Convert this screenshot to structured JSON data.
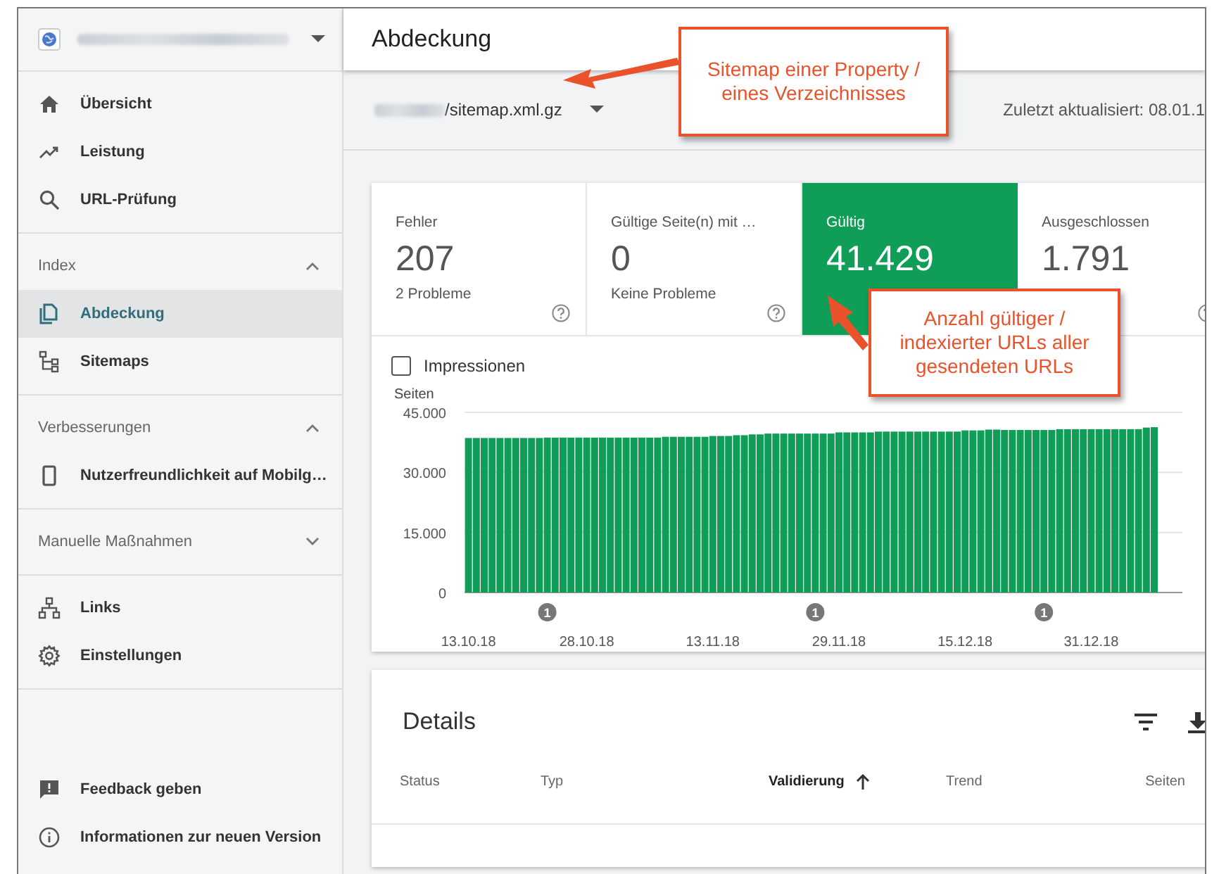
{
  "sidebar": {
    "sections": [
      {
        "items": [
          {
            "label": "Übersicht",
            "selected": false
          },
          {
            "label": "Leistung",
            "selected": false
          },
          {
            "label": "URL-Prüfung",
            "selected": false
          }
        ]
      },
      {
        "title": "Index",
        "expanded": true,
        "items": [
          {
            "label": "Abdeckung",
            "selected": true
          },
          {
            "label": "Sitemaps",
            "selected": false
          }
        ]
      },
      {
        "title": "Verbesserungen",
        "expanded": true,
        "items": [
          {
            "label": "Nutzerfreundlichkeit auf Mobilg…",
            "selected": false
          }
        ]
      },
      {
        "title": "Manuelle Maßnahmen",
        "expanded": false
      },
      {
        "items": [
          {
            "label": "Links",
            "selected": false
          },
          {
            "label": "Einstellungen",
            "selected": false
          }
        ]
      }
    ],
    "footer": [
      {
        "label": "Feedback geben"
      },
      {
        "label": "Informationen zur neuen Version"
      }
    ]
  },
  "page": {
    "title": "Abdeckung"
  },
  "toolbar": {
    "sitemap": "/sitemap.xml.gz",
    "updated": "Zuletzt aktualisiert: 08.01.1"
  },
  "tiles": [
    {
      "label": "Fehler",
      "value": "207",
      "caption": "2 Probleme",
      "selected": false
    },
    {
      "label": "Gültige Seite(n) mit …",
      "value": "0",
      "caption": "Keine Probleme",
      "selected": false
    },
    {
      "label": "Gültig",
      "value": "41.429",
      "selected": true
    },
    {
      "label": "Ausgeschlossen",
      "value": "1.791",
      "selected": false
    }
  ],
  "impressions": {
    "label": "Impressionen",
    "checked": false
  },
  "chart_data": {
    "type": "bar",
    "ylabel": "Seiten",
    "ylim": [
      0,
      45000
    ],
    "yticks": [
      {
        "value": 0,
        "label": "0"
      },
      {
        "value": 15000,
        "label": "15.000"
      },
      {
        "value": 30000,
        "label": "30.000"
      },
      {
        "value": 45000,
        "label": "45.000"
      }
    ],
    "categories": [
      "13.10.18",
      null,
      null,
      null,
      null,
      null,
      null,
      null,
      null,
      null,
      null,
      null,
      null,
      null,
      null,
      "28.10.18",
      null,
      null,
      null,
      null,
      null,
      null,
      null,
      null,
      null,
      null,
      null,
      null,
      null,
      null,
      null,
      "13.11.18",
      null,
      null,
      null,
      null,
      null,
      null,
      null,
      null,
      null,
      null,
      null,
      null,
      null,
      null,
      null,
      "29.11.18",
      null,
      null,
      null,
      null,
      null,
      null,
      null,
      null,
      null,
      null,
      null,
      null,
      null,
      null,
      null,
      "15.12.18",
      null,
      null,
      null,
      null,
      null,
      null,
      null,
      null,
      null,
      null,
      null,
      null,
      null,
      null,
      null,
      "31.12.18",
      null,
      null,
      null,
      null,
      null,
      null,
      null,
      null
    ],
    "series": [
      {
        "color": "#0f9d58",
        "values": [
          38600,
          38600,
          38600,
          38600,
          38600,
          38600,
          38600,
          38600,
          38600,
          38600,
          38700,
          38700,
          38700,
          38700,
          38700,
          38700,
          38700,
          38700,
          38700,
          38700,
          38700,
          38700,
          38700,
          38700,
          38700,
          38900,
          38900,
          38900,
          38900,
          38900,
          38900,
          39100,
          39100,
          39100,
          39300,
          39300,
          39500,
          39500,
          39700,
          39700,
          39700,
          39700,
          39700,
          39700,
          39700,
          39700,
          39700,
          40000,
          40000,
          40000,
          40000,
          40000,
          40200,
          40200,
          40200,
          40200,
          40200,
          40200,
          40200,
          40200,
          40200,
          40200,
          40200,
          40500,
          40500,
          40500,
          40700,
          40700,
          40600,
          40600,
          40600,
          40600,
          40600,
          40600,
          40600,
          40800,
          40800,
          40800,
          40800,
          40800,
          40800,
          40800,
          40800,
          40800,
          40800,
          40800,
          41200,
          41300
        ]
      }
    ],
    "annotations": [
      "1",
      "1",
      "1"
    ]
  },
  "details": {
    "title": "Details",
    "columns": [
      {
        "label": "Status",
        "sorted": false
      },
      {
        "label": "Typ",
        "sorted": false
      },
      {
        "label": "Validierung",
        "sorted": true
      },
      {
        "label": "Trend",
        "sorted": false
      },
      {
        "label": "Seiten",
        "sorted": false
      }
    ]
  },
  "callouts": [
    {
      "text": "Sitemap einer Property / eines Verzeichnisses"
    },
    {
      "text": "Anzahl gültiger / indexierter URLs aller gesendeten URLs"
    }
  ]
}
